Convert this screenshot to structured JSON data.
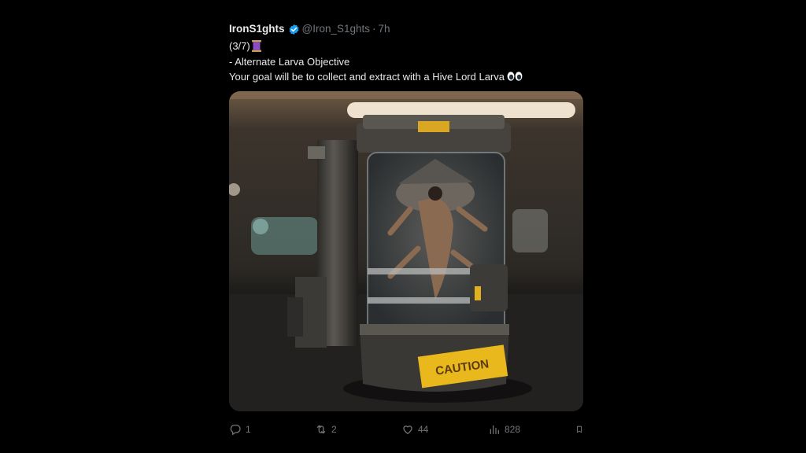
{
  "tweet": {
    "author_name": "IronS1ghts",
    "handle": "@Iron_S1ghts",
    "separator": "·",
    "time": "7h",
    "lines": [
      "(3/7)",
      "- Alternate Larva Objective",
      "Your goal will be to collect and extract with a Hive Lord Larva"
    ],
    "media": {
      "caution_label": "CAUTION"
    },
    "actions": {
      "replies": "1",
      "reposts": "2",
      "likes": "44",
      "views": "828"
    }
  },
  "colors": {
    "background": "#000000",
    "text": "#e7e9ea",
    "muted": "#71767b",
    "verified": "#1d9bf0",
    "caution_yellow": "#e8b81c"
  },
  "icons": [
    "verified-badge-icon",
    "thread-spool-emoji-icon",
    "eyes-emoji-icon",
    "reply-icon",
    "repost-icon",
    "like-icon",
    "views-icon",
    "bookmark-icon"
  ]
}
